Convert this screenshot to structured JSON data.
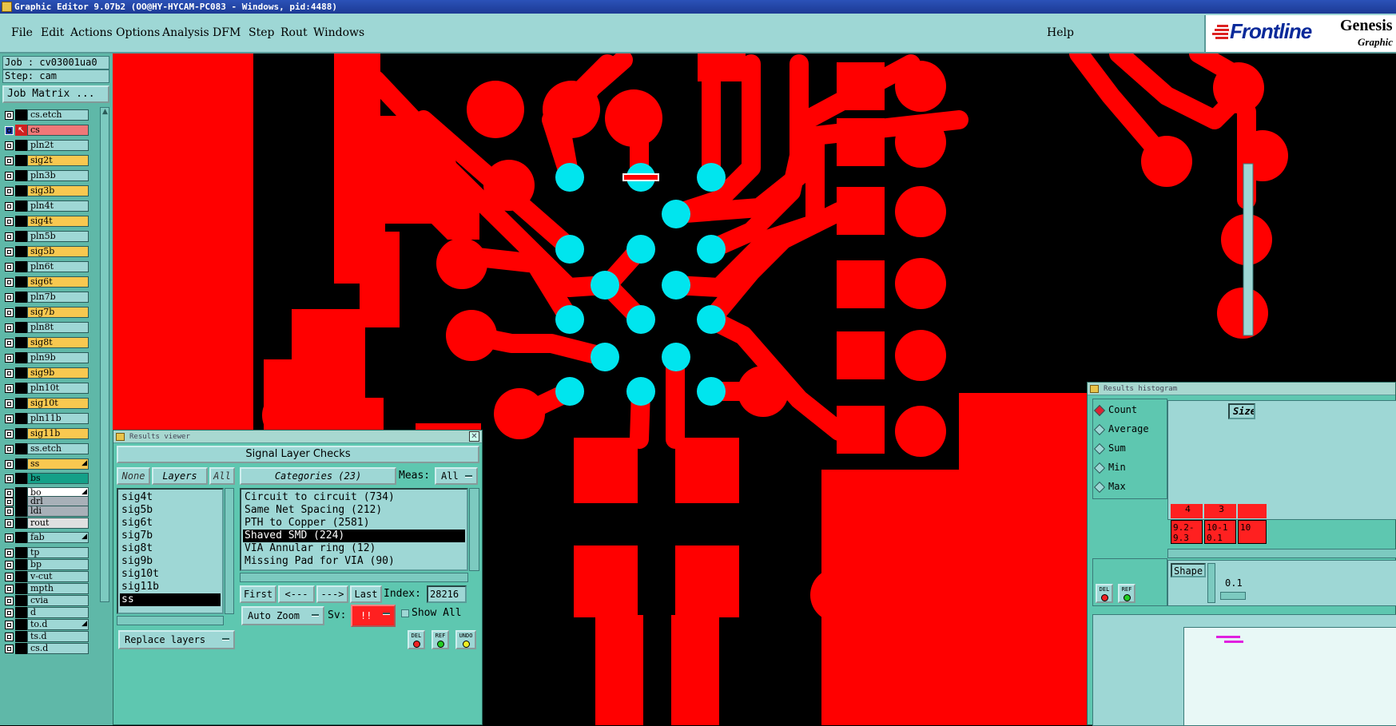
{
  "window": {
    "title": "Graphic Editor 9.07b2 (OO@HY-HYCAM-PC083 - Windows, pid:4488)"
  },
  "menu": {
    "items": [
      "File",
      "Edit",
      "Actions",
      "Options",
      "Analysis",
      "DFM",
      "Step",
      "Rout",
      "Windows"
    ],
    "help": "Help"
  },
  "logo": {
    "brand": "Frontline",
    "product": "Genesis",
    "subtitle": "Graphic"
  },
  "job": {
    "job_label": "Job : cv03001ua0",
    "step_label": "Step: cam",
    "matrix_button": "Job Matrix ..."
  },
  "layers": [
    {
      "name": "cs.etch",
      "color": "#9ed7d5"
    },
    {
      "name": "cs",
      "color": "#f07878",
      "work": true
    },
    {
      "name": "pln2t",
      "color": "#9ed7d5"
    },
    {
      "name": "sig2t",
      "color": "#f8c850"
    },
    {
      "name": "pln3b",
      "color": "#9ed7d5"
    },
    {
      "name": "sig3b",
      "color": "#f8c850"
    },
    {
      "name": "pln4t",
      "color": "#9ed7d5"
    },
    {
      "name": "sig4t",
      "color": "#f8c850"
    },
    {
      "name": "pln5b",
      "color": "#9ed7d5"
    },
    {
      "name": "sig5b",
      "color": "#f8c850"
    },
    {
      "name": "pln6t",
      "color": "#9ed7d5"
    },
    {
      "name": "sig6t",
      "color": "#f8c850"
    },
    {
      "name": "pln7b",
      "color": "#9ed7d5"
    },
    {
      "name": "sig7b",
      "color": "#f8c850"
    },
    {
      "name": "pln8t",
      "color": "#9ed7d5"
    },
    {
      "name": "sig8t",
      "color": "#f8c850"
    },
    {
      "name": "pln9b",
      "color": "#9ed7d5"
    },
    {
      "name": "sig9b",
      "color": "#f8c850"
    },
    {
      "name": "pln10t",
      "color": "#9ed7d5"
    },
    {
      "name": "sig10t",
      "color": "#f8c850"
    },
    {
      "name": "pln11b",
      "color": "#9ed7d5"
    },
    {
      "name": "sig11b",
      "color": "#f8c850"
    },
    {
      "name": "ss.etch",
      "color": "#9ed7d5"
    },
    {
      "name": "ss",
      "color": "#f8c850",
      "mark": "◢"
    },
    {
      "name": "bs",
      "color": "#14a088"
    },
    {
      "name": "bo",
      "color": "#ffffff",
      "mark": "◢"
    },
    {
      "name": "drl",
      "color": "#a8b0b8"
    },
    {
      "name": "ldi",
      "color": "#a8b0b8"
    },
    {
      "name": "rout",
      "color": "#e0e0e0"
    },
    {
      "name": "fab",
      "color": "#9ed7d5",
      "mark": "◢"
    },
    {
      "name": "tp",
      "color": "#9ed7d5"
    },
    {
      "name": "bp",
      "color": "#9ed7d5"
    },
    {
      "name": "v-cut",
      "color": "#9ed7d5"
    },
    {
      "name": "mpth",
      "color": "#9ed7d5"
    },
    {
      "name": "cvia",
      "color": "#9ed7d5"
    },
    {
      "name": "d",
      "color": "#9ed7d5"
    },
    {
      "name": "to.d",
      "color": "#9ed7d5",
      "mark": "◢"
    },
    {
      "name": "ts.d",
      "color": "#9ed7d5"
    },
    {
      "name": "cs.d",
      "color": "#9ed7d5"
    }
  ],
  "results_viewer": {
    "title": "Results viewer",
    "header": "Signal Layer Checks",
    "none_btn": "None",
    "layers_btn": "Layers",
    "all_btn": "All",
    "categories_btn": "Categories (23)",
    "meas_label": "Meas:",
    "meas_value": "All",
    "layer_items": [
      "sig4t",
      "sig5b",
      "sig6t",
      "sig7b",
      "sig8t",
      "sig9b",
      "sig10t",
      "sig11b",
      "ss"
    ],
    "selected_layer": "ss",
    "categories": [
      "Circuit to circuit (734)",
      "Same Net Spacing (212)",
      "PTH to Copper (2581)",
      "Shaved SMD (224)",
      "VIA Annular ring (12)",
      "Missing Pad for VIA (90)"
    ],
    "selected_category": "Shaved SMD (224)",
    "first_btn": "First",
    "prev_btn": "<---",
    "next_btn": "--->",
    "last_btn": "Last",
    "index_label": "Index:",
    "index_value": "28216",
    "autozoom_btn": "Auto Zoom",
    "sv_label": "Sv:",
    "sv_value": "!!",
    "showall_label": "Show All",
    "replace_btn": "Replace layers",
    "del_btn": "DEL",
    "ref_btn": "REF",
    "undo_btn": "UNDO"
  },
  "histogram": {
    "title": "Results histogram",
    "options": [
      "Count",
      "Average",
      "Sum",
      "Min",
      "Max"
    ],
    "selected": "Count",
    "size_label": "Size",
    "bars": [
      {
        "count": "4",
        "range": "9.2-9.3"
      },
      {
        "count": "3",
        "range": "10-10.1"
      },
      {
        "count": "",
        "range": "10"
      }
    ],
    "shape_label": "Shape",
    "value": "0.1",
    "del_btn": "DEL",
    "ref_btn": "REF"
  },
  "colors": {
    "copper": "#ff0000",
    "pads": "#00e5ee",
    "background": "#000000",
    "panel": "#5ec7b0",
    "field": "#9ed7d5"
  }
}
